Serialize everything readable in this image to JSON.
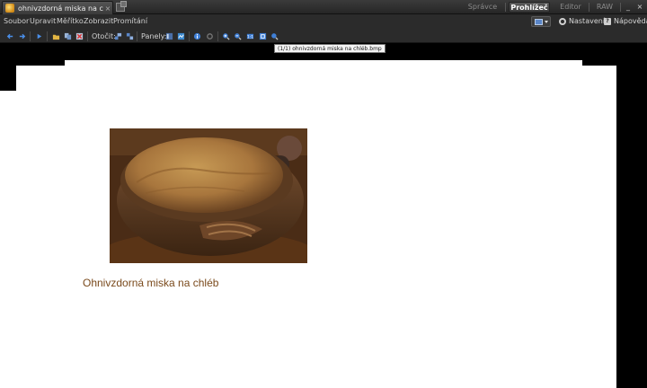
{
  "tab": {
    "title": "ohnivzdorná miska na ch...",
    "close": "×"
  },
  "modes": [
    {
      "label": "Správce",
      "active": false
    },
    {
      "label": "Prohlížeč",
      "active": true
    },
    {
      "label": "Editor",
      "active": false
    },
    {
      "label": "RAW",
      "active": false
    }
  ],
  "window_buttons": {
    "minimize": "_",
    "close": "×"
  },
  "menu": {
    "items": [
      {
        "label": "Soubor",
        "accel": "S"
      },
      {
        "label": "Upravit",
        "accel": "U"
      },
      {
        "label": "Měřítko",
        "accel": "M"
      },
      {
        "label": "Zobrazit",
        "accel": "Z"
      },
      {
        "label": "Promítání",
        "accel": "P"
      }
    ],
    "settings_label": "Nastavení",
    "help_label": "Nápověda"
  },
  "toolbar": {
    "rotate_label": "Otočit:",
    "panels_label": "Panely:"
  },
  "tooltip": "(1/1) ohnivzdorná miska na chléb.bmp",
  "document": {
    "caption": "Ohnivzdorná miska na chléb"
  },
  "colors": {
    "caption": "#7a4a1c",
    "accent_blue": "#3f7fd6"
  }
}
